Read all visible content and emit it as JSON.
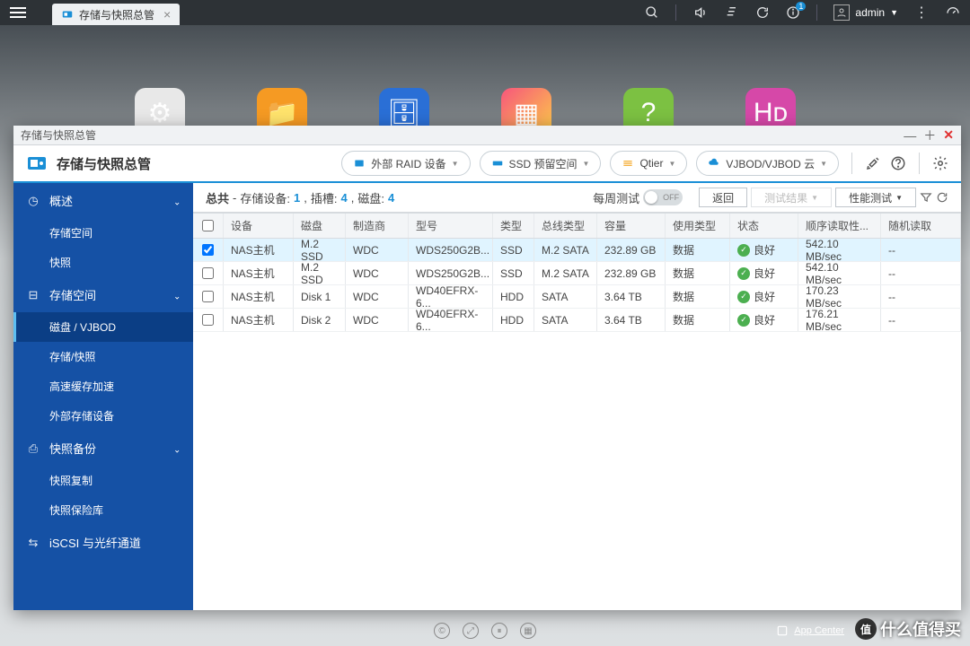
{
  "topbar": {
    "tab_title": "存储与快照总管",
    "user": "admin"
  },
  "desktop": {
    "icons": [
      {
        "bg": "#e8e8e8",
        "glyph": "⚙"
      },
      {
        "bg": "#f59a23",
        "glyph": "📁"
      },
      {
        "bg": "#2a6fd6",
        "glyph": "🗄"
      },
      {
        "bg": "linear-gradient(135deg,#f7567c,#fcd046)",
        "glyph": "▦"
      },
      {
        "bg": "#7cc142",
        "glyph": "?"
      },
      {
        "bg": "#d648a8",
        "glyph": "Hᴅ"
      }
    ]
  },
  "window": {
    "title": "存储与快照总管",
    "app_title": "存储与快照总管",
    "pills": {
      "raid": "外部 RAID 设备",
      "ssd": "SSD 预留空间",
      "qtier": "Qtier",
      "vjbod": "VJBOD/VJBOD 云"
    }
  },
  "sidebar": {
    "g1": "概述",
    "g1_items": [
      "存储空间",
      "快照"
    ],
    "g2": "存储空间",
    "g2_items": [
      "磁盘 / VJBOD",
      "存储/快照",
      "高速缓存加速",
      "外部存储设备"
    ],
    "g3": "快照备份",
    "g3_items": [
      "快照复制",
      "快照保险库"
    ],
    "g4": "iSCSI 与光纤通道"
  },
  "summary": {
    "total_label": "总共",
    "dev_label": "存储设备:",
    "dev_val": "1",
    "slot_label": "插槽:",
    "slot_val": "4",
    "disk_label": "磁盘:",
    "disk_val": "4",
    "test_label": "每周测试",
    "toggle": "OFF",
    "back": "返回",
    "result": "测试结果",
    "perf": "性能测试"
  },
  "table": {
    "headers": [
      "设备",
      "磁盘",
      "制造商",
      "型号",
      "类型",
      "总线类型",
      "容量",
      "使用类型",
      "状态",
      "顺序读取性...",
      "随机读取"
    ],
    "rows": [
      {
        "sel": true,
        "dev": "NAS主机",
        "disk": "M.2 SSD",
        "mfr": "WDC",
        "model": "WDS250G2B...",
        "type": "SSD",
        "bus": "M.2 SATA",
        "cap": "232.89 GB",
        "use": "数据",
        "stat": "良好",
        "read": "542.10 MB/sec",
        "rand": "--"
      },
      {
        "sel": false,
        "dev": "NAS主机",
        "disk": "M.2 SSD",
        "mfr": "WDC",
        "model": "WDS250G2B...",
        "type": "SSD",
        "bus": "M.2 SATA",
        "cap": "232.89 GB",
        "use": "数据",
        "stat": "良好",
        "read": "542.10 MB/sec",
        "rand": "--"
      },
      {
        "sel": false,
        "dev": "NAS主机",
        "disk": "Disk 1",
        "mfr": "WDC",
        "model": "WD40EFRX-6...",
        "type": "HDD",
        "bus": "SATA",
        "cap": "3.64 TB",
        "use": "数据",
        "stat": "良好",
        "read": "170.23 MB/sec",
        "rand": "--"
      },
      {
        "sel": false,
        "dev": "NAS主机",
        "disk": "Disk 2",
        "mfr": "WDC",
        "model": "WD40EFRX-6...",
        "type": "HDD",
        "bus": "SATA",
        "cap": "3.64 TB",
        "use": "数据",
        "stat": "良好",
        "read": "176.21 MB/sec",
        "rand": "--"
      }
    ]
  },
  "footer": {
    "appcenter": "App Center",
    "watermark": "什么值得买"
  }
}
